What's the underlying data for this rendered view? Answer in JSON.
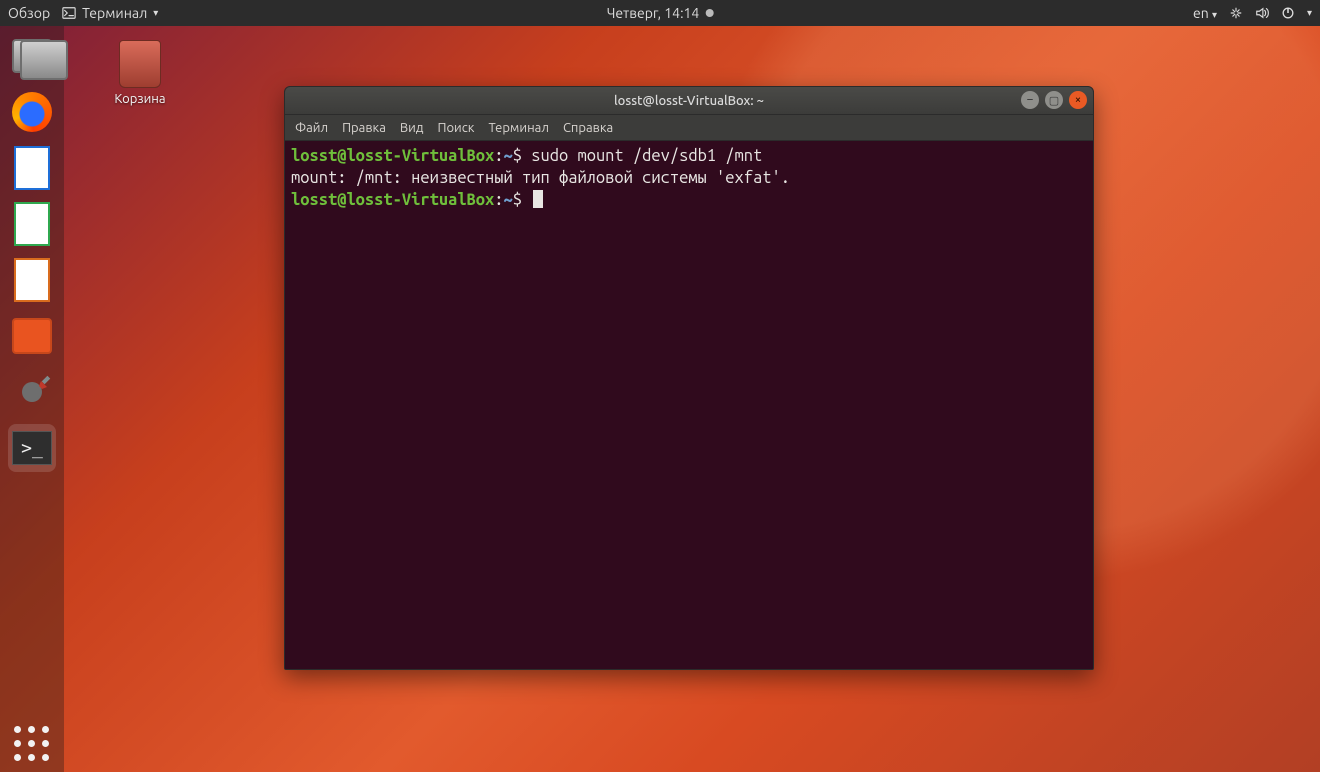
{
  "topbar": {
    "activities": "Обзор",
    "app_name": "Терминал",
    "clock": "Четверг, 14:14",
    "lang": "en"
  },
  "desktop": {
    "trash_label": "Корзина"
  },
  "launcher": {
    "items": [
      {
        "name": "files",
        "label": "Файлы"
      },
      {
        "name": "firefox",
        "label": "Firefox"
      },
      {
        "name": "writer",
        "label": "LibreOffice Writer"
      },
      {
        "name": "calc",
        "label": "LibreOffice Calc"
      },
      {
        "name": "impress",
        "label": "LibreOffice Impress"
      },
      {
        "name": "software",
        "label": "Программы Ubuntu"
      },
      {
        "name": "settings",
        "label": "Настройки"
      },
      {
        "name": "terminal",
        "label": "Терминал"
      }
    ]
  },
  "window": {
    "title": "losst@losst-VirtualBox: ~",
    "menu": {
      "file": "Файл",
      "edit": "Правка",
      "view": "Вид",
      "search": "Поиск",
      "terminal": "Терминал",
      "help": "Справка"
    }
  },
  "terminal": {
    "prompt_user": "losst@losst-VirtualBox",
    "prompt_sep": ":",
    "prompt_path": "~",
    "prompt_end": "$ ",
    "lines": [
      {
        "type": "cmd",
        "text": "sudo mount /dev/sdb1 /mnt"
      },
      {
        "type": "out",
        "text": "mount: /mnt: неизвестный тип файловой системы 'exfat'."
      },
      {
        "type": "cmd",
        "text": ""
      }
    ]
  }
}
